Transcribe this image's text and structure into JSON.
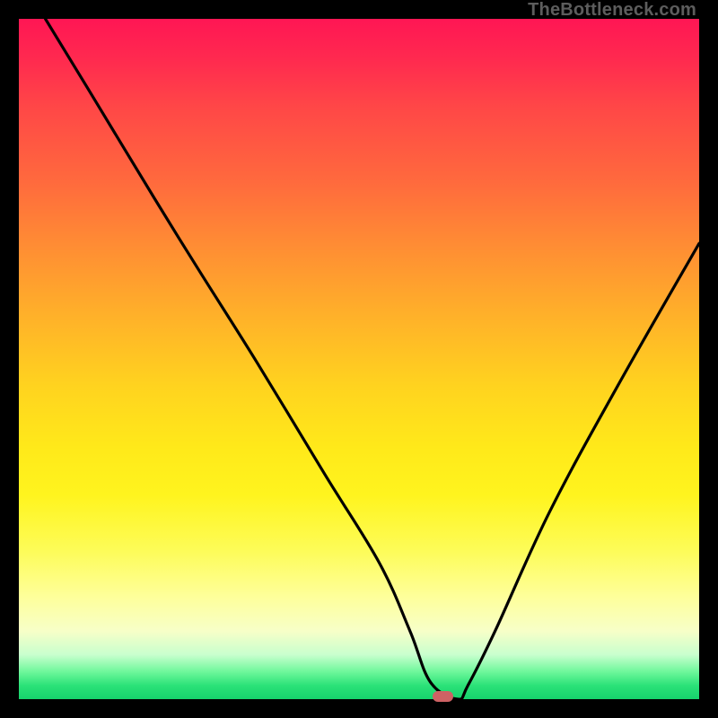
{
  "watermark": "TheBottleneck.com",
  "marker": {
    "x_pct": 62.4,
    "y_pct": 99.6
  },
  "chart_data": {
    "type": "line",
    "title": "",
    "xlabel": "",
    "ylabel": "",
    "xlim": [
      0,
      100
    ],
    "ylim": [
      0,
      100
    ],
    "series": [
      {
        "name": "bottleneck-curve",
        "x": [
          3.9,
          10,
          20,
          26.5,
          35,
          45,
          53,
          57.5,
          60.5,
          64.5,
          66,
          70,
          78,
          88,
          100
        ],
        "y": [
          100,
          90,
          73.5,
          63,
          49.5,
          33,
          20,
          10,
          2.5,
          0,
          2,
          10,
          27.5,
          46,
          67
        ]
      }
    ],
    "gradient_stops": [
      {
        "pct": 0,
        "color": "#ff1654"
      },
      {
        "pct": 6,
        "color": "#ff2a4f"
      },
      {
        "pct": 13,
        "color": "#ff4747"
      },
      {
        "pct": 24,
        "color": "#ff6a3d"
      },
      {
        "pct": 34,
        "color": "#ff8f33"
      },
      {
        "pct": 44,
        "color": "#ffb229"
      },
      {
        "pct": 54,
        "color": "#ffd31f"
      },
      {
        "pct": 63,
        "color": "#ffe91a"
      },
      {
        "pct": 70,
        "color": "#fff41e"
      },
      {
        "pct": 78,
        "color": "#fdfc57"
      },
      {
        "pct": 85,
        "color": "#feff9b"
      },
      {
        "pct": 90,
        "color": "#f7ffc8"
      },
      {
        "pct": 93.5,
        "color": "#c8ffce"
      },
      {
        "pct": 96,
        "color": "#6df79a"
      },
      {
        "pct": 98,
        "color": "#2be278"
      },
      {
        "pct": 100,
        "color": "#16d36c"
      }
    ],
    "marker": {
      "x": 62.4,
      "y": 0.4,
      "color": "#ce6264"
    }
  }
}
